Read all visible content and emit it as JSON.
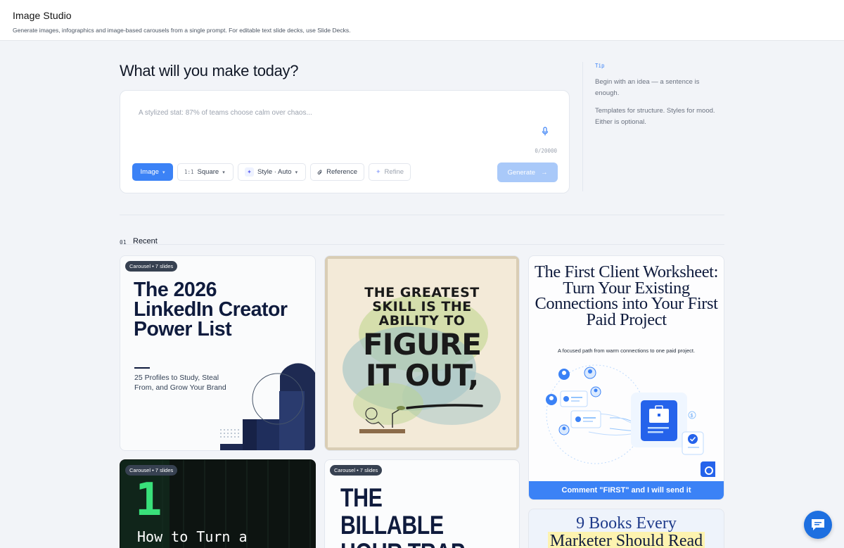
{
  "header": {
    "title": "Image Studio",
    "subtitle": "Generate images, infographics and image-based carousels from a single prompt. For editable text slide decks, use Slide Decks."
  },
  "main": {
    "heading": "What will you make today?",
    "prompt_placeholder": "A stylized stat: 87% of teams choose calm over chaos...",
    "char_counter": "0/20000",
    "toolbar": {
      "type_label": "Image",
      "ratio_code": "1:1",
      "ratio_label": "Square",
      "style_label": "Style · Auto",
      "reference_label": "Reference",
      "refine_label": "Refine",
      "generate_label": "Generate"
    }
  },
  "tip": {
    "label": "Tip",
    "line1": "Begin with an idea — a sentence is enough.",
    "line2": "Templates for structure. Styles for mood. Either is optional."
  },
  "recent": {
    "number": "01",
    "title": "Recent",
    "cards": [
      {
        "badge": "Carousel • 7 slides",
        "title": "The 2026 LinkedIn Creator Power List",
        "subtitle": "25 Profiles to Study, Steal From, and Grow Your Brand"
      },
      {
        "line1": "THE GREATEST",
        "line2": "SKILL IS THE",
        "line3": "ABILITY TO",
        "line4": "FIGURE",
        "line5": "IT OUT,"
      },
      {
        "title": "The First Client Worksheet: Turn Your Existing Connections into Your First Paid Project",
        "subtitle": "A focused path from warm connections to one paid project.",
        "footer": "Comment \"FIRST\" and I will send it"
      },
      {
        "badge": "Carousel • 7 slides",
        "number": "1",
        "text": "How to Turn a"
      },
      {
        "badge": "Carousel • 7 slides",
        "line1": "THE",
        "line2": "BILLABLE",
        "line3": "HOUR TRAP"
      },
      {
        "line1": "9 Books Every",
        "line2": "Marketer Should Read"
      }
    ]
  },
  "colors": {
    "accent": "#3b82f6",
    "navy": "#0f1b3d",
    "green": "#39e07a"
  }
}
